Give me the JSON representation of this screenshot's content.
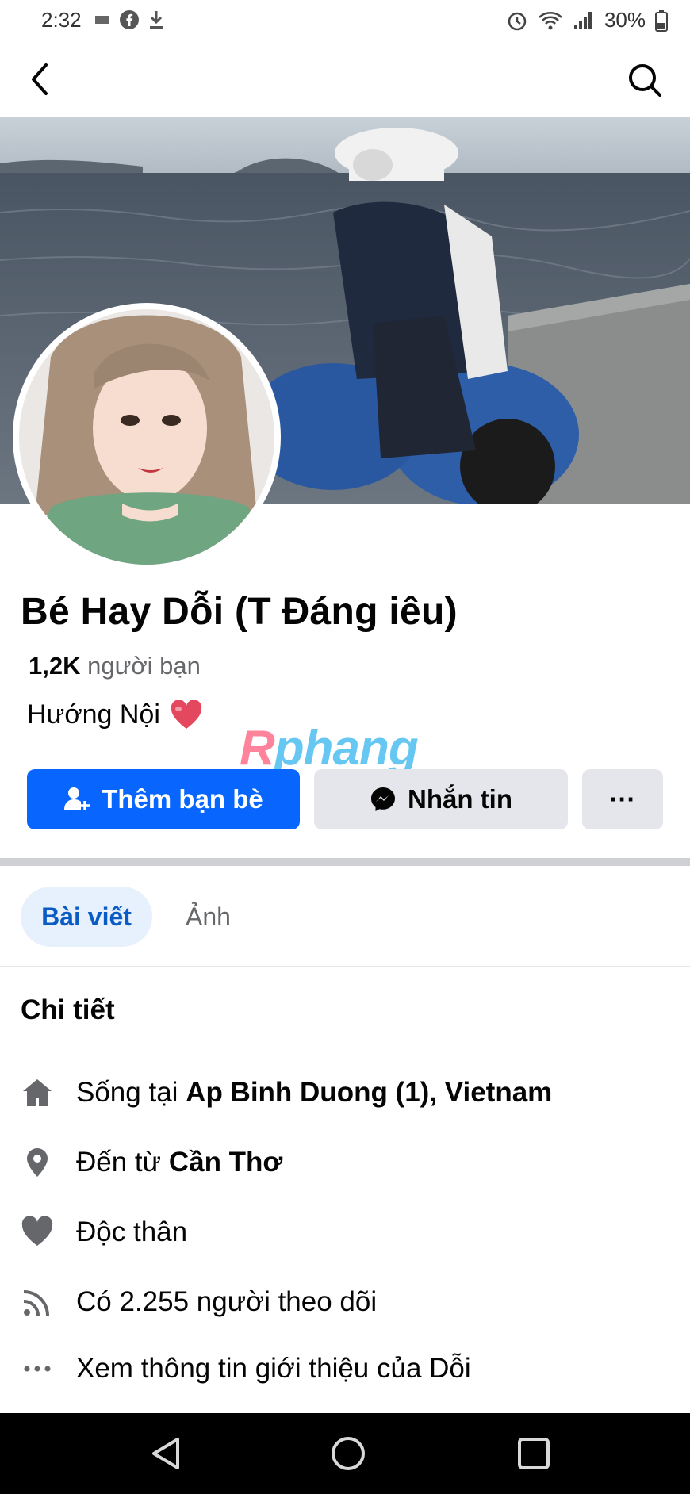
{
  "status_bar": {
    "time": "2:32",
    "battery": "30%"
  },
  "profile": {
    "name": "Bé Hay Dỗi (T Đáng iêu)",
    "friends_count": "1,2K",
    "friends_label": "người bạn",
    "bio": "Hướng Nội"
  },
  "watermark": {
    "part1": "R",
    "part2": "phang"
  },
  "actions": {
    "add_friend_label": "Thêm bạn bè",
    "message_label": "Nhắn tin",
    "more_label": "···"
  },
  "tabs": [
    {
      "label": "Bài viết"
    },
    {
      "label": "Ảnh"
    }
  ],
  "details": {
    "title": "Chi tiết",
    "lives_prefix": "Sống tại",
    "lives_place": "Ap Binh Duong (1), Vietnam",
    "from_prefix": "Đến từ",
    "from_place": "Cần Thơ",
    "relationship": "Độc thân",
    "followers": "Có 2.255 người theo dõi",
    "see_about": "Xem thông tin giới thiệu của Dỗi"
  },
  "icons": {
    "back": "back-arrow-icon",
    "search": "search-icon",
    "home": "home-icon",
    "location": "location-pin-icon",
    "heart": "heart-icon",
    "followers": "rss-icon",
    "more": "ellipsis-icon"
  },
  "colors": {
    "primary": "#0866ff",
    "tab_active_bg": "#e7f0fd",
    "tab_active_text": "#0a5bc4"
  }
}
